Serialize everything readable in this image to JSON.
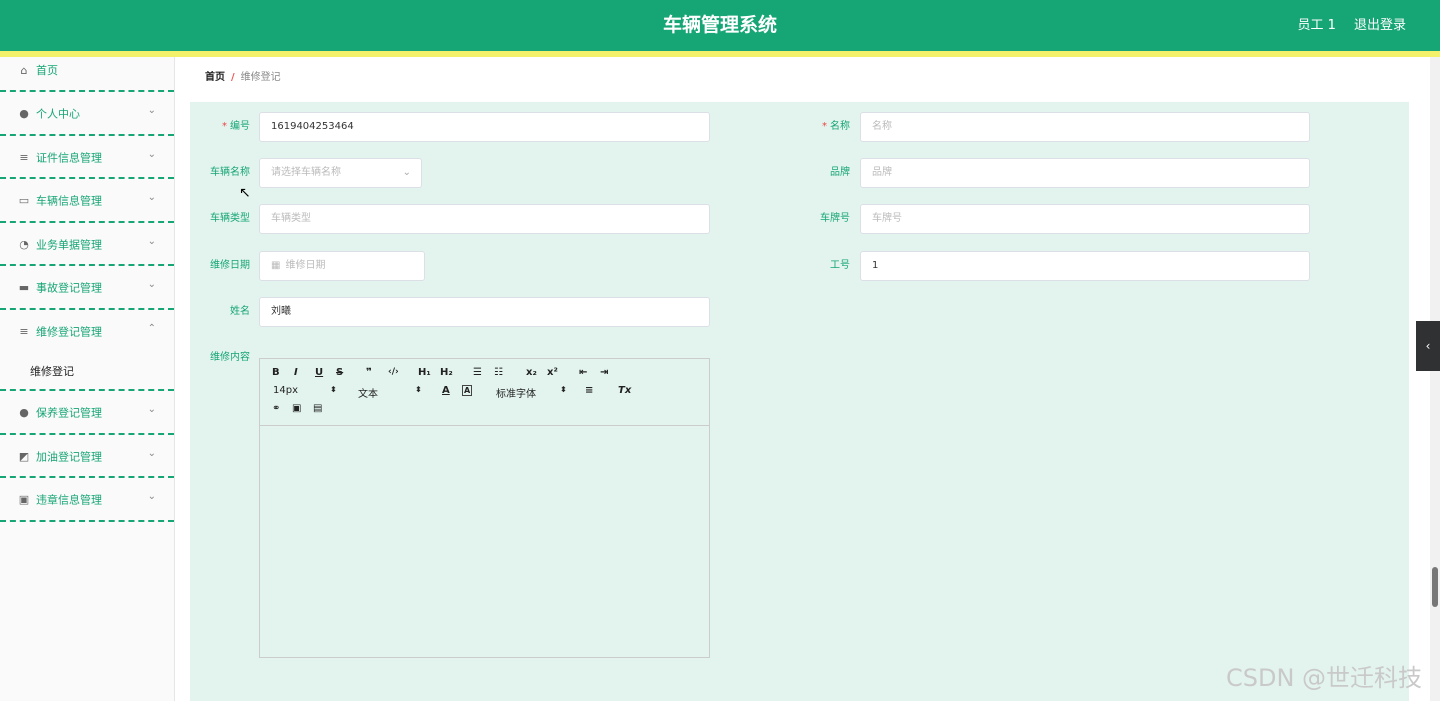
{
  "header": {
    "title": "车辆管理系统",
    "user": "员工 1",
    "logout": "退出登录"
  },
  "sidebar": {
    "items": [
      {
        "label": "首页",
        "icon": "home-icon"
      },
      {
        "label": "个人中心",
        "icon": "user-icon"
      },
      {
        "label": "证件信息管理",
        "icon": "list-icon"
      },
      {
        "label": "车辆信息管理",
        "icon": "chat-icon"
      },
      {
        "label": "业务单据管理",
        "icon": "gauge-icon"
      },
      {
        "label": "事故登记管理",
        "icon": "message-icon"
      },
      {
        "label": "维修登记管理",
        "icon": "list-icon"
      },
      {
        "label": "保养登记管理",
        "icon": "user-icon"
      },
      {
        "label": "加油登记管理",
        "icon": "chart-icon"
      },
      {
        "label": "违章信息管理",
        "icon": "clipboard-icon"
      }
    ],
    "submenu": "维修登记"
  },
  "breadcrumb": {
    "home": "首页",
    "sep": "/",
    "current": "维修登记"
  },
  "form": {
    "biaohao": {
      "label": "编号",
      "value": "1619404253464"
    },
    "mingcheng": {
      "label": "名称",
      "placeholder": "名称"
    },
    "cheliangmingcheng": {
      "label": "车辆名称",
      "placeholder": "请选择车辆名称"
    },
    "pinpai": {
      "label": "品牌",
      "placeholder": "品牌"
    },
    "cheliangleixing": {
      "label": "车辆类型",
      "placeholder": "车辆类型"
    },
    "chepaihao": {
      "label": "车牌号",
      "placeholder": "车牌号"
    },
    "weixiuriqi": {
      "label": "维修日期",
      "placeholder": "维修日期"
    },
    "gonghao": {
      "label": "工号",
      "value": "1"
    },
    "xingming": {
      "label": "姓名",
      "value": "刘曦"
    },
    "weixiuneirong": {
      "label": "维修内容"
    }
  },
  "editor": {
    "size": "14px",
    "format": "文本",
    "font": "标准字体",
    "buttons": {
      "bold": "B",
      "italic": "I",
      "underline": "U",
      "strike": "S",
      "quote": "❞",
      "code": "‹/›",
      "h1": "H₁",
      "h2": "H₂",
      "ol": "☰",
      "ul": "☷",
      "sub": "x₂",
      "sup": "x²",
      "indent_dec": "⇤",
      "indent_inc": "⇥",
      "color": "A",
      "bg": "A",
      "align": "≡",
      "clean": "Tx",
      "link": "🔗",
      "image": "▣",
      "video": "▤"
    }
  },
  "watermark": "CSDN @世迁科技",
  "colors": {
    "primary": "#16a574",
    "accent": "#f3f06a",
    "form_bg": "#e3f4ee"
  }
}
